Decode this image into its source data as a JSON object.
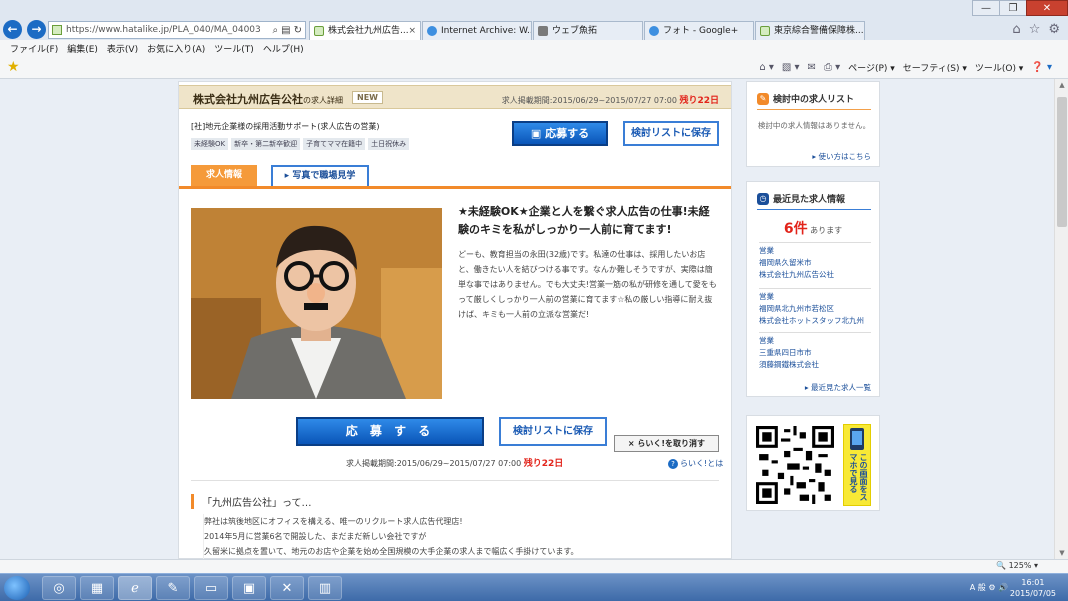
{
  "browser": {
    "url": "https://www.hatalike.jp/PLA_040/MA_04003",
    "tabs": [
      {
        "label": "株式会社九州広告..."
      },
      {
        "label": "Internet Archive: W..."
      },
      {
        "label": "ウェブ魚拓"
      },
      {
        "label": "フォト - Google+"
      },
      {
        "label": "東京綜合警備保障株..."
      }
    ],
    "menu": [
      "ファイル(F)",
      "編集(E)",
      "表示(V)",
      "お気に入り(A)",
      "ツール(T)",
      "ヘルプ(H)"
    ],
    "commands": {
      "page": "ページ(P) ▾",
      "safety": "セーフティ(S) ▾",
      "tools": "ツール(O) ▾"
    },
    "zoom": "🔍 125% ▾"
  },
  "job": {
    "company": "株式会社九州広告公社",
    "company_suffix": "の求人詳細",
    "new_badge": "NEW",
    "period_label": "求人掲載期間:2015/06/29~2015/07/27 07:00",
    "remain": "残り22日",
    "subtitle": "[社]地元企業様の採用活動サポート(求人広告の営業)",
    "tags": [
      "未経験OK",
      "新卒・第二新卒歓迎",
      "子育てママ在籍中",
      "土日祝休み"
    ],
    "apply_label": "応募する",
    "apply_label_big": "応 募 す る",
    "save_label": "検討リストに保存",
    "tab_info": "求人情報",
    "tab_photo": "▸ 写真で職場見学",
    "headline": "★未経験OK★企業と人を繋ぐ求人広告の仕事!未経験のキミを私がしっかり一人前に育てます!",
    "body": "どーも、教育担当の永田(32歳)です。私達の仕事は、採用したいお店と、働きたい人を結びつける事です。なんか難しそうですが、実際は簡単な事ではありません。でも大丈夫!営業一筋の私が研修を通して愛をもって厳しくしっかり一人前の営業に育てます☆私の厳しい指導に耐え抜けば、キミも一人前の立派な営業だ!",
    "rakuku_cancel": "× らいく!を取り消す",
    "rakuku_help": "らいく!とは",
    "about_title": "「九州広告公社」って…",
    "about_lines": [
      "弊社は筑後地区にオフィスを構える、唯一のリクルート求人広告代理店!",
      "2014年5月に営業6名で開設した、まだまだ新しい会社ですが",
      "久留米に拠点を置いて、地元のお店や企業を始め全国規模の大手企業の求人まで幅広く手掛けています。"
    ]
  },
  "sidebar": {
    "consider_title": "検討中の求人リスト",
    "consider_empty": "検討中の求人情報はありません。",
    "consider_howto": "▸ 使い方はこちら",
    "recent_title": "最近見た求人情報",
    "recent_count": "6件",
    "recent_count_suffix": "あります",
    "recent_items": [
      {
        "category": "営業",
        "location": "福岡県久留米市",
        "company": "株式会社九州広告公社"
      },
      {
        "category": "営業",
        "location": "福岡県北九州市若松区",
        "company": "株式会社ホットスタッフ北九州"
      },
      {
        "category": "営業",
        "location": "三重県四日市市",
        "company": "須藤鋼鐵株式会社"
      }
    ],
    "recent_more": "▸ 最近見た求人一覧",
    "phone_text": "この画面をスマホで見る"
  },
  "taskbar": {
    "tray": "A 般 ⚙ 🔊",
    "time": "16:01",
    "date": "2015/07/05"
  }
}
